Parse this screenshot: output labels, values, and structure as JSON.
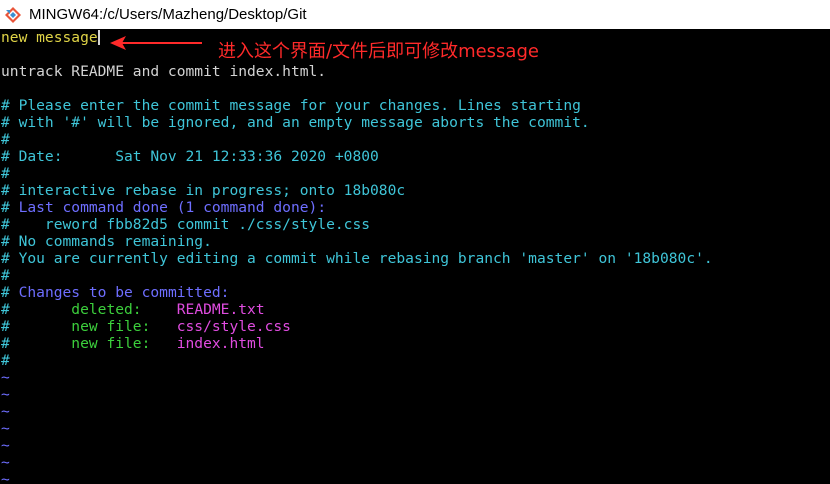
{
  "window": {
    "title": "MINGW64:/c/Users/Mazheng/Desktop/Git",
    "icon": "git-bash-icon"
  },
  "editor": {
    "lines": [
      {
        "text": "new message",
        "color": "yellow"
      },
      {
        "text": "",
        "color": "white"
      },
      {
        "text": "untrack README and commit index.html.",
        "color": "white"
      },
      {
        "text": "",
        "color": "white"
      },
      {
        "text": "# Please enter the commit message for your changes. Lines starting",
        "color": "cyan"
      },
      {
        "text": "# with '#' will be ignored, and an empty message aborts the commit.",
        "color": "cyan"
      },
      {
        "text": "#",
        "color": "cyan"
      },
      {
        "text": "# Date:      Sat Nov 21 12:33:36 2020 +0800",
        "color": "cyan"
      },
      {
        "text": "#",
        "color": "cyan"
      },
      {
        "text": "# interactive rebase in progress; onto 18b080c",
        "color": "cyan"
      },
      {
        "text": "# Last command done (1 command done):",
        "color": "mixed_blue"
      },
      {
        "text": "#    reword fbb82d5 commit ./css/style.css",
        "color": "cyan"
      },
      {
        "text": "# No commands remaining.",
        "color": "cyan"
      },
      {
        "text": "# You are currently editing a commit while rebasing branch 'master' on '18b080c'.",
        "color": "cyan"
      },
      {
        "text": "#",
        "color": "cyan"
      },
      {
        "text": "# Changes to be committed:",
        "color": "mixed_blue"
      },
      {
        "text": "#       deleted:    README.txt",
        "color": "change"
      },
      {
        "text": "#       new file:   css/style.css",
        "color": "change"
      },
      {
        "text": "#       new file:   index.html",
        "color": "change"
      },
      {
        "text": "#",
        "color": "cyan"
      },
      {
        "text": "~",
        "color": "blue"
      },
      {
        "text": "~",
        "color": "blue"
      },
      {
        "text": "~",
        "color": "blue"
      },
      {
        "text": "~",
        "color": "blue"
      },
      {
        "text": "~",
        "color": "blue"
      },
      {
        "text": "~",
        "color": "blue"
      },
      {
        "text": "~",
        "color": "blue"
      }
    ],
    "changes": [
      {
        "status": "deleted:",
        "file": "README.txt"
      },
      {
        "status": "new file:",
        "file": "css/style.css"
      },
      {
        "status": "new file:",
        "file": "index.html"
      }
    ]
  },
  "annotation": {
    "text": "进入这个界面/文件后即可修改message",
    "color": "#ff2a2a"
  },
  "colors": {
    "background": "#000000",
    "comment": "#3fc5d8",
    "text": "#d3d3d3",
    "subject": "#e0d447",
    "heading": "#6e6eff",
    "status": "#3ccf3c",
    "filename": "#e04ce0"
  }
}
